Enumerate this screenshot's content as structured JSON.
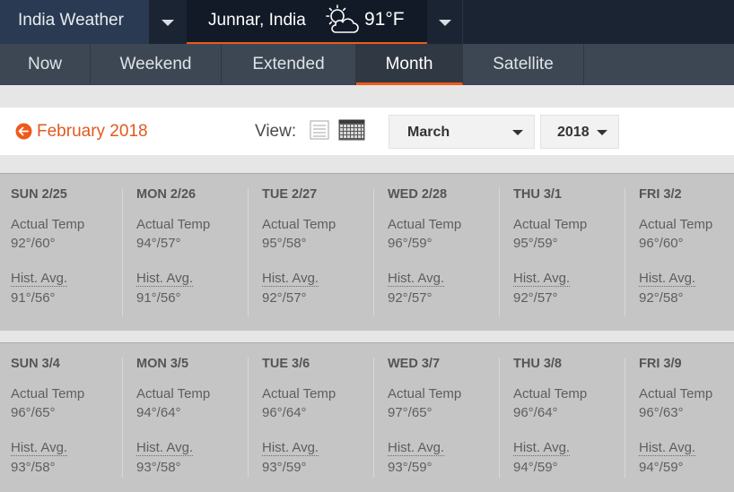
{
  "header": {
    "region": "India Weather",
    "location": "Junnar, India",
    "current_temp": "91°F",
    "weather_icon": "partly-cloudy-sun-icon"
  },
  "nav": {
    "tabs": [
      "Now",
      "Weekend",
      "Extended",
      "Month",
      "Satellite"
    ],
    "active_tab": "Month"
  },
  "month_bar": {
    "prev_month": "February 2018",
    "view_label": "View:",
    "month_select": "March",
    "year_select": "2018"
  },
  "calendar": {
    "actual_label": "Actual Temp",
    "hist_label": "Hist. Avg.",
    "weeks": [
      [
        {
          "date": "SUN 2/25",
          "actual": "92°/60°",
          "hist": "91°/56°"
        },
        {
          "date": "MON 2/26",
          "actual": "94°/57°",
          "hist": "91°/56°"
        },
        {
          "date": "TUE 2/27",
          "actual": "95°/58°",
          "hist": "92°/57°"
        },
        {
          "date": "WED 2/28",
          "actual": "96°/59°",
          "hist": "92°/57°"
        },
        {
          "date": "THU 3/1",
          "actual": "95°/59°",
          "hist": "92°/57°"
        },
        {
          "date": "FRI 3/2",
          "actual": "96°/60°",
          "hist": "92°/58°"
        }
      ],
      [
        {
          "date": "SUN 3/4",
          "actual": "96°/65°",
          "hist": "93°/58°"
        },
        {
          "date": "MON 3/5",
          "actual": "94°/64°",
          "hist": "93°/58°"
        },
        {
          "date": "TUE 3/6",
          "actual": "96°/64°",
          "hist": "93°/59°"
        },
        {
          "date": "WED 3/7",
          "actual": "97°/65°",
          "hist": "93°/59°"
        },
        {
          "date": "THU 3/8",
          "actual": "96°/64°",
          "hist": "94°/59°"
        },
        {
          "date": "FRI 3/9",
          "actual": "96°/63°",
          "hist": "94°/59°"
        }
      ]
    ]
  },
  "colors": {
    "accent": "#ef5a1a",
    "header_bg": "#1a2433",
    "nav_bg": "#3d4754",
    "calendar_bg": "#c5c5c5"
  }
}
